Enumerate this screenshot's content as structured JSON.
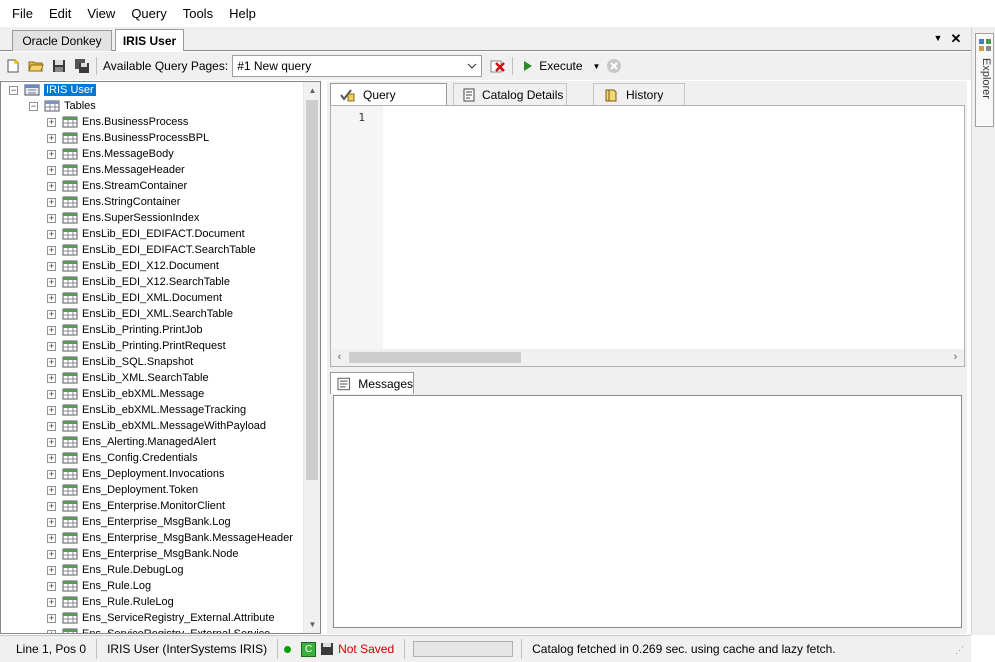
{
  "menu": [
    "File",
    "Edit",
    "View",
    "Query",
    "Tools",
    "Help"
  ],
  "doc_tabs": {
    "inactive": "Oracle Donkey",
    "active": "IRIS User"
  },
  "toolbar": {
    "query_pages_label": "Available Query Pages:",
    "query_page_value": "#1 New query",
    "execute_label": "Execute"
  },
  "tree": {
    "root": "IRIS User",
    "tables_node": "Tables",
    "items": [
      "Ens.BusinessProcess",
      "Ens.BusinessProcessBPL",
      "Ens.MessageBody",
      "Ens.MessageHeader",
      "Ens.StreamContainer",
      "Ens.StringContainer",
      "Ens.SuperSessionIndex",
      "EnsLib_EDI_EDIFACT.Document",
      "EnsLib_EDI_EDIFACT.SearchTable",
      "EnsLib_EDI_X12.Document",
      "EnsLib_EDI_X12.SearchTable",
      "EnsLib_EDI_XML.Document",
      "EnsLib_EDI_XML.SearchTable",
      "EnsLib_Printing.PrintJob",
      "EnsLib_Printing.PrintRequest",
      "EnsLib_SQL.Snapshot",
      "EnsLib_XML.SearchTable",
      "EnsLib_ebXML.Message",
      "EnsLib_ebXML.MessageTracking",
      "EnsLib_ebXML.MessageWithPayload",
      "Ens_Alerting.ManagedAlert",
      "Ens_Config.Credentials",
      "Ens_Deployment.Invocations",
      "Ens_Deployment.Token",
      "Ens_Enterprise.MonitorClient",
      "Ens_Enterprise_MsgBank.Log",
      "Ens_Enterprise_MsgBank.MessageHeader",
      "Ens_Enterprise_MsgBank.Node",
      "Ens_Rule.DebugLog",
      "Ens_Rule.Log",
      "Ens_Rule.RuleLog",
      "Ens_ServiceRegistry_External.Attribute",
      "Ens_ServiceRegistry_External.Service"
    ]
  },
  "query_tabs": [
    "Query",
    "Catalog Details",
    "History"
  ],
  "editor": {
    "line_number": "1"
  },
  "messages_tab": "Messages",
  "side_panel": {
    "label": "Explorer"
  },
  "status": {
    "position": "Line 1, Pos 0",
    "connection": "IRIS User (InterSystems IRIS)",
    "save_state": "Not Saved",
    "message": "Catalog fetched in 0.269 sec. using cache and lazy fetch."
  },
  "colors": {
    "selection": "#0078d7",
    "not_saved": "#d00000",
    "connected": "#00a000"
  }
}
